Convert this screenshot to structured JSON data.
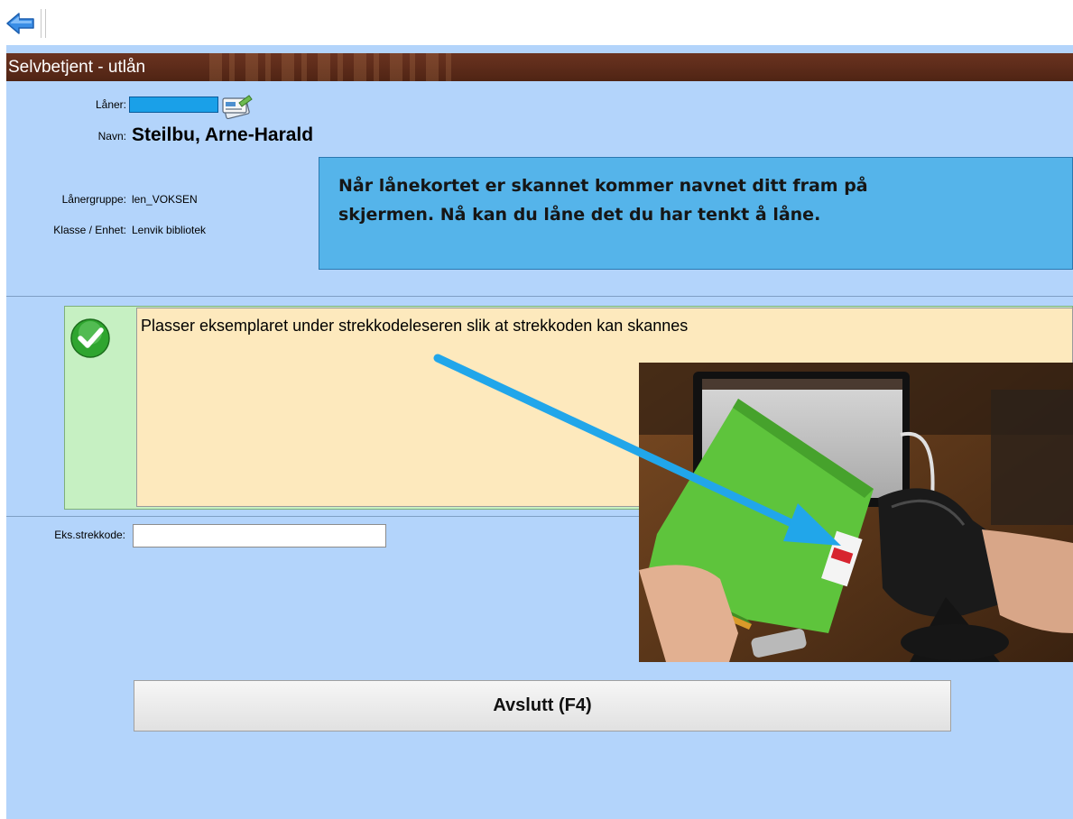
{
  "window": {
    "title": "Selvbetjent - utlån"
  },
  "patron": {
    "laner_label": "Låner:",
    "name_label": "Navn:",
    "name": "Steilbu, Arne-Harald",
    "group_label": "Lånergruppe:",
    "group": "len_VOKSEN",
    "unit_label": "Klasse / Enhet:",
    "unit": "Lenvik bibliotek"
  },
  "callout": {
    "line1": "Når lånekortet er skannet kommer navnet ditt fram på",
    "line2": "skjermen. Nå kan du låne det du har tenkt å låne."
  },
  "message": {
    "text": "Plasser eksemplaret under strekkodeleseren slik at strekkoden kan skannes"
  },
  "barcode": {
    "label": "Eks.strekkode:",
    "value": ""
  },
  "buttons": {
    "exit": "Avslutt (F4)"
  },
  "icons": {
    "back": "back-arrow-icon",
    "card": "library-card-icon",
    "status": "checkmark-icon"
  },
  "colors": {
    "title_bar": "#5c2a18",
    "background": "#b3d4fb",
    "callout": "#55b4ea",
    "message": "#fde9bd",
    "message_border": "#c6f0c2",
    "annotation_arrow": "#21a6ea"
  }
}
